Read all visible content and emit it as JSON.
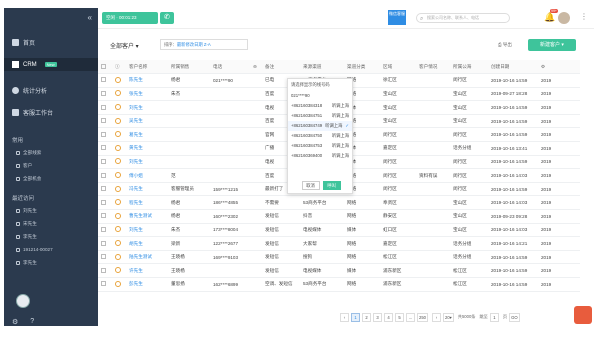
{
  "sidebar": {
    "collapse_icon": "double-chevron-left-icon",
    "home": "首页",
    "crm": "CRM",
    "crm_badge": "New",
    "stats": "统计分析",
    "workbench": "客服工作台",
    "common_title": "常用",
    "common_items": [
      "全部线索",
      "客户",
      "全部机会"
    ],
    "recent_title": "最近访问",
    "recent_items": [
      "刘先生",
      "宋先生",
      "李先生",
      "191214-00027",
      "李先生"
    ]
  },
  "topbar": {
    "call_status": "空闲 · 00:01:23",
    "brand_label": "微信客服",
    "search_placeholder": "搜索公司名称、联系人、电话",
    "bell_badge": "99+"
  },
  "toolbar": {
    "all_customers": "全部客户",
    "sort_label": "排序：",
    "sort_value": "最新修改日期 Z-A",
    "export": "导出",
    "new_button": "新建客户"
  },
  "table": {
    "headers": [
      "",
      "",
      "客户名称",
      "所属销售",
      "电话",
      "",
      "备注",
      "来源渠道",
      "渠道分类",
      "区域",
      "客户情况",
      "所属公海",
      "创建日期",
      ""
    ],
    "rows": [
      [
        "陈先生",
        "杨君",
        "021****90",
        "",
        "已电",
        "53商务平台",
        "网络",
        "徐汇区",
        "",
        "闵行区",
        "2019-10-16 14:59",
        "2019"
      ],
      [
        "张先生",
        "朱杰",
        "",
        "",
        "百度",
        "百度大搜索",
        "网络",
        "宝山区",
        "",
        "宝山区",
        "2019-09-27 18:28",
        "2019"
      ],
      [
        "刘先生",
        "",
        "",
        "",
        "电视",
        "电视媒体",
        "媒体",
        "宝山区",
        "",
        "宝山区",
        "2019-10-16 14:59",
        "2019"
      ],
      [
        "吴先生",
        "",
        "",
        "",
        "百度",
        "百度大搜索",
        "网络",
        "宝山区",
        "",
        "宝山区",
        "2019-10-16 14:59",
        "2019"
      ],
      [
        "葛先生",
        "",
        "",
        "",
        "官网",
        "官网注册",
        "网络",
        "闵行区",
        "",
        "闵行区",
        "2019-10-16 14:59",
        "2019"
      ],
      [
        "黄先生",
        "",
        "",
        "",
        "广播",
        "广播",
        "媒体",
        "嘉定区",
        "",
        "话务分组",
        "2019-10-16 13:41",
        "2019"
      ],
      [
        "刘先生",
        "",
        "",
        "",
        "电视",
        "电视媒体",
        "媒体",
        "闵行区",
        "",
        "闵行区",
        "2019-10-16 14:59",
        "2019"
      ],
      [
        "傅小姐",
        "范",
        "",
        "",
        "百度",
        "百度大搜索",
        "网络",
        "闵行区",
        "资料有误",
        "闵行区",
        "2019-10-16 14:03",
        "2019"
      ],
      [
        "冯先生",
        "客服管理员",
        "159****1215",
        "",
        "最新打了",
        "今日头条",
        "网络",
        "闵行区",
        "",
        "闵行区",
        "2019-10-16 14:59",
        "2019"
      ],
      [
        "程先生",
        "杨君",
        "186****4855",
        "",
        "不需要",
        "53商务平台",
        "网络",
        "奉贤区",
        "",
        "宝山区",
        "2019-10-16 14:03",
        "2019"
      ],
      [
        "曹先生测试",
        "杨君",
        "160****2302",
        "",
        "发短信",
        "抖音",
        "网络",
        "静安区",
        "",
        "宝山区",
        "2019-09-23 09:28",
        "2019"
      ],
      [
        "刘先生",
        "朱杰",
        "173****8004",
        "",
        "发短信",
        "电视媒体",
        "媒体",
        "虹口区",
        "",
        "宝山区",
        "2019-10-16 14:03",
        "2019"
      ],
      [
        "胡先生",
        "梁新",
        "122****2677",
        "",
        "发短信",
        "大家帮",
        "网络",
        "嘉定区",
        "",
        "话务分组",
        "2019-10-16 14:21",
        "2019"
      ],
      [
        "陆先生测试",
        "王晓杨",
        "169****9103",
        "",
        "发短信",
        "搜狗",
        "网络",
        "松江区",
        "",
        "话务分组",
        "2019-10-16 14:59",
        "2019"
      ],
      [
        "许先生",
        "王晓杨",
        "",
        "",
        "发短信",
        "电视媒体",
        "媒体",
        "浦东新区",
        "",
        "松江区",
        "2019-10-16 14:59",
        "2019"
      ],
      [
        "彭先生",
        "董思扬",
        "162****6899",
        "",
        "空调、发短信",
        "53商务平台",
        "网络",
        "浦东新区",
        "",
        "松江区",
        "2019-10-16 14:59",
        "2019"
      ]
    ]
  },
  "popup": {
    "title": "请选择显示的线号码",
    "lines": [
      {
        "number": "021****90",
        "label": ""
      },
      {
        "number": "+862160384318",
        "label": "听调上海"
      },
      {
        "number": "+862160384751",
        "label": "听调上海"
      },
      {
        "number": "+862160384749",
        "label": "听调上海"
      },
      {
        "number": "+862160384750",
        "label": "听调上海"
      },
      {
        "number": "+862160384753",
        "label": "听调上海"
      },
      {
        "number": "+862160369400",
        "label": "听调上海"
      }
    ],
    "cancel": "取消",
    "confirm": "呼叫"
  },
  "pager": {
    "pages": [
      "1",
      "2",
      "3",
      "4",
      "5",
      "...",
      "250"
    ],
    "per_page": "20",
    "jump_label": "跳至",
    "jump_value": "1",
    "page_unit": "页",
    "go": "GO",
    "summary": "共5000条"
  }
}
